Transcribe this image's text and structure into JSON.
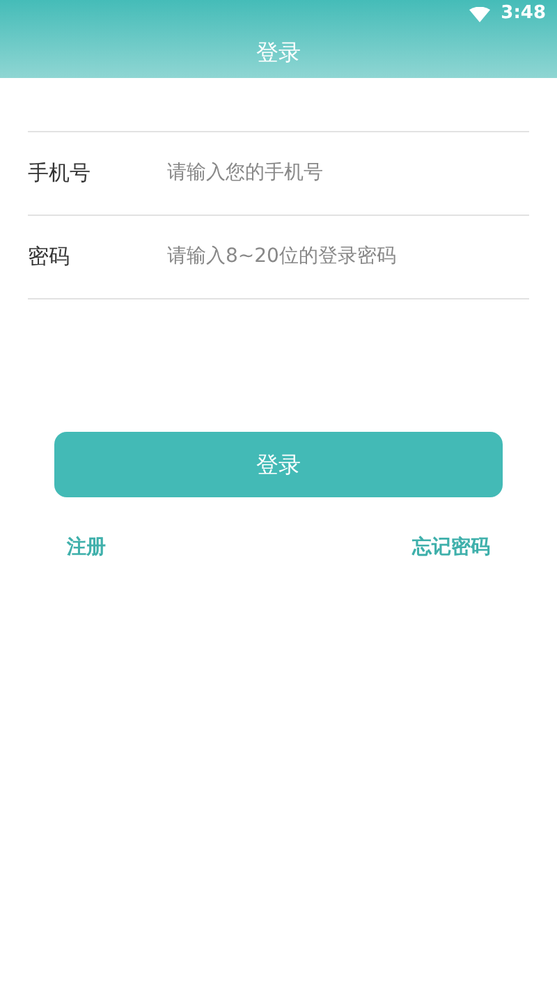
{
  "status_bar": {
    "time": "3:48"
  },
  "app_bar": {
    "title": "登录"
  },
  "fields": [
    {
      "label": "手机号",
      "placeholder": "请输入您的手机号"
    },
    {
      "label": "密码",
      "placeholder": "请输入8~20位的登录密码"
    }
  ],
  "login_button": "登录",
  "links": [
    "注册",
    "忘记密码"
  ]
}
